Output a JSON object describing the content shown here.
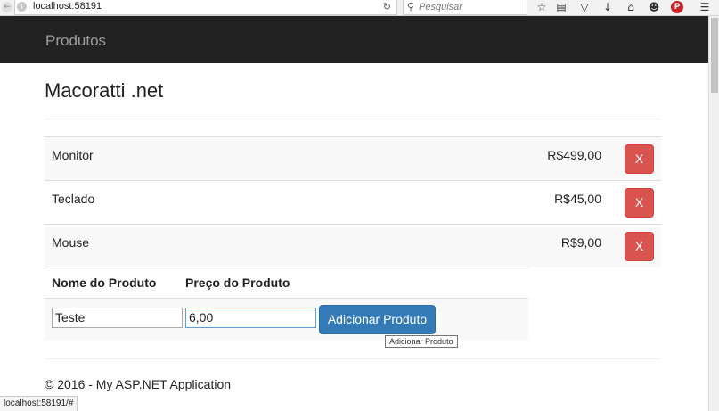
{
  "browser": {
    "url": "localhost:58191",
    "search_placeholder": "Pesquisar",
    "status_url": "localhost:58191/#",
    "icons": [
      "back-icon",
      "site-info-icon",
      "reload-icon",
      "search-icon",
      "bookmark-star-icon",
      "reading-list-icon",
      "pocket-icon",
      "download-icon",
      "home-icon",
      "smiley-icon",
      "pinterest-icon",
      "hamburger-menu-icon"
    ]
  },
  "navbar": {
    "brand": "Produtos"
  },
  "page": {
    "title": "Macoratti .net"
  },
  "products": [
    {
      "name": "Monitor",
      "price": "R$499,00",
      "delete_label": "X"
    },
    {
      "name": "Teclado",
      "price": "R$45,00",
      "delete_label": "X"
    },
    {
      "name": "Mouse",
      "price": "R$9,00",
      "delete_label": "X"
    }
  ],
  "form": {
    "name_header": "Nome do Produto",
    "price_header": "Preço do Produto",
    "name_value": "Teste",
    "price_value": "6,00",
    "add_label": "Adicionar Produto",
    "add_tooltip": "Adicionar Produto"
  },
  "footer": {
    "text": "© 2016 - My ASP.NET Application"
  },
  "colors": {
    "navbar": "#222222",
    "danger": "#d9534f",
    "primary": "#337ab7"
  }
}
